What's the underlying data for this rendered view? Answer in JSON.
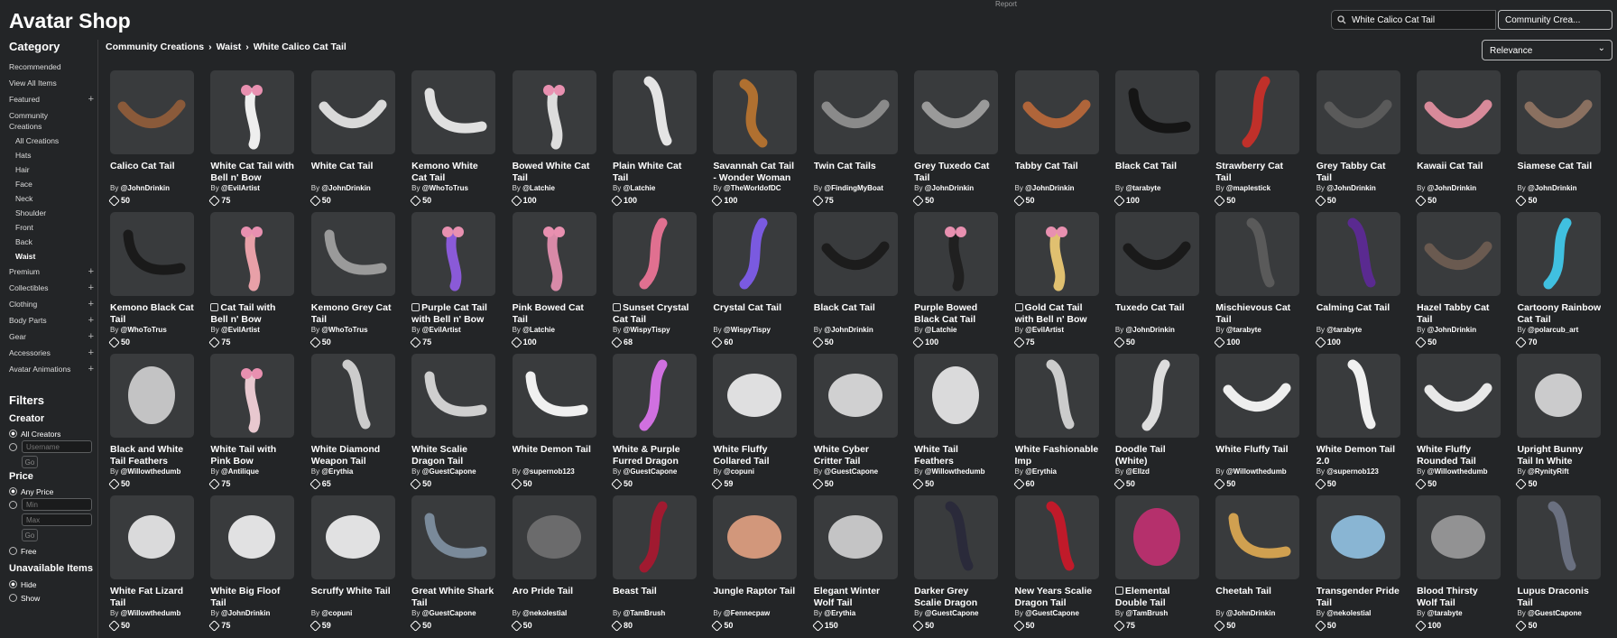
{
  "header": {
    "title": "Avatar Shop",
    "report": "Report"
  },
  "search": {
    "value": "White Calico Cat Tail",
    "category": "Community Crea..."
  },
  "sort": {
    "label": "Relevance"
  },
  "breadcrumb": [
    "Community Creations",
    "Waist",
    "White Calico Cat Tail"
  ],
  "sidebar": {
    "heading": "Category",
    "items": [
      {
        "label": "Recommended",
        "plus": false,
        "sub": false
      },
      {
        "label": "View All Items",
        "plus": false,
        "sub": false
      },
      {
        "label": "Featured",
        "plus": true,
        "sub": false
      },
      {
        "label": "Community Creations",
        "plus": false,
        "sub": false
      },
      {
        "label": "All Creations",
        "plus": false,
        "sub": true
      },
      {
        "label": "Hats",
        "plus": false,
        "sub": true
      },
      {
        "label": "Hair",
        "plus": false,
        "sub": true
      },
      {
        "label": "Face",
        "plus": false,
        "sub": true
      },
      {
        "label": "Neck",
        "plus": false,
        "sub": true
      },
      {
        "label": "Shoulder",
        "plus": false,
        "sub": true
      },
      {
        "label": "Front",
        "plus": false,
        "sub": true
      },
      {
        "label": "Back",
        "plus": false,
        "sub": true
      },
      {
        "label": "Waist",
        "plus": false,
        "sub": true,
        "active": true
      },
      {
        "label": "Premium",
        "plus": true,
        "sub": false
      },
      {
        "label": "Collectibles",
        "plus": true,
        "sub": false
      },
      {
        "label": "Clothing",
        "plus": true,
        "sub": false
      },
      {
        "label": "Body Parts",
        "plus": true,
        "sub": false
      },
      {
        "label": "Gear",
        "plus": true,
        "sub": false
      },
      {
        "label": "Accessories",
        "plus": true,
        "sub": false
      },
      {
        "label": "Avatar Animations",
        "plus": true,
        "sub": false
      }
    ]
  },
  "filters": {
    "heading": "Filters",
    "creator": {
      "label": "Creator",
      "all": "All Creators",
      "username_placeholder": "Username",
      "go": "Go"
    },
    "price": {
      "label": "Price",
      "any": "Any Price",
      "min_placeholder": "Min",
      "max_placeholder": "Max",
      "go": "Go",
      "free": "Free"
    },
    "unavailable": {
      "label": "Unavailable Items",
      "hide": "Hide",
      "show": "Show"
    }
  },
  "colors": {
    "background": "#232527",
    "tile": "#393b3d"
  },
  "items": [
    {
      "name": "Calico Cat Tail",
      "creator": "@JohnDrinkin",
      "price": "50",
      "badge": false,
      "color": "#8a5a3a",
      "shape": "curl"
    },
    {
      "name": "White Cat Tail with Bell n' Bow",
      "creator": "@EvilArtist",
      "price": "75",
      "badge": false,
      "color": "#eeeeee",
      "shape": "bow"
    },
    {
      "name": "White Cat Tail",
      "creator": "@JohnDrinkin",
      "price": "50",
      "badge": false,
      "color": "#d9d9d9",
      "shape": "curl"
    },
    {
      "name": "Kemono White Cat Tail",
      "creator": "@WhoToTrus",
      "price": "50",
      "badge": false,
      "color": "#e0e0e0",
      "shape": "swoop"
    },
    {
      "name": "Bowed White Cat Tail",
      "creator": "@Latchie",
      "price": "100",
      "badge": false,
      "color": "#dddddd",
      "shape": "bow"
    },
    {
      "name": "Plain White Cat Tail",
      "creator": "@Latchie",
      "price": "100",
      "badge": false,
      "color": "#e4e4e4",
      "shape": "hook"
    },
    {
      "name": "Savannah Cat Tail - Wonder Woman",
      "creator": "@TheWorldofDC",
      "price": "100",
      "badge": false,
      "color": "#b07030",
      "shape": "s"
    },
    {
      "name": "Twin Cat Tails",
      "creator": "@FindingMyBoat",
      "price": "75",
      "badge": false,
      "color": "#8a8a8a",
      "shape": "curl"
    },
    {
      "name": "Grey Tuxedo Cat Tail",
      "creator": "@JohnDrinkin",
      "price": "50",
      "badge": false,
      "color": "#9a9a9a",
      "shape": "curl"
    },
    {
      "name": "Tabby Cat Tail",
      "creator": "@JohnDrinkin",
      "price": "50",
      "badge": false,
      "color": "#b0653a",
      "shape": "curl"
    },
    {
      "name": "Black Cat Tail",
      "creator": "@tarabyte",
      "price": "100",
      "badge": false,
      "color": "#151515",
      "shape": "swoop"
    },
    {
      "name": "Strawberry Cat Tail",
      "creator": "@maplestick",
      "price": "50",
      "badge": false,
      "color": "#c0302a",
      "shape": "vertical"
    },
    {
      "name": "Grey Tabby Cat Tail",
      "creator": "@JohnDrinkin",
      "price": "50",
      "badge": false,
      "color": "#5a5a5a",
      "shape": "curl"
    },
    {
      "name": "Kawaii Cat Tail",
      "creator": "@JohnDrinkin",
      "price": "50",
      "badge": false,
      "color": "#d88a9a",
      "shape": "curl"
    },
    {
      "name": "Siamese Cat Tail",
      "creator": "@JohnDrinkin",
      "price": "50",
      "badge": false,
      "color": "#8a7060",
      "shape": "curl"
    },
    {
      "name": "Kemono Black Cat Tail",
      "creator": "@WhoToTrus",
      "price": "50",
      "badge": false,
      "color": "#1a1a1a",
      "shape": "swoop"
    },
    {
      "name": "Cat Tail with Bell n' Bow",
      "creator": "@EvilArtist",
      "price": "75",
      "badge": true,
      "color": "#e8a0a8",
      "shape": "bow"
    },
    {
      "name": "Kemono Grey Cat Tail",
      "creator": "@WhoToTrus",
      "price": "50",
      "badge": false,
      "color": "#9a9a9a",
      "shape": "swoop"
    },
    {
      "name": "Purple Cat Tail with Bell n' Bow",
      "creator": "@EvilArtist",
      "price": "75",
      "badge": true,
      "color": "#8a5ad8",
      "shape": "bow"
    },
    {
      "name": "Pink Bowed Cat Tail",
      "creator": "@Latchie",
      "price": "100",
      "badge": false,
      "color": "#d88aa8",
      "shape": "bow"
    },
    {
      "name": "Sunset Crystal Cat Tail",
      "creator": "@WispyTispy",
      "price": "68",
      "badge": true,
      "color": "#e07090",
      "shape": "vertical"
    },
    {
      "name": "Crystal Cat Tail",
      "creator": "@WispyTispy",
      "price": "60",
      "badge": false,
      "color": "#7a5ae0",
      "shape": "vertical"
    },
    {
      "name": "Black Cat Tail",
      "creator": "@JohnDrinkin",
      "price": "50",
      "badge": false,
      "color": "#1c1c1c",
      "shape": "curl"
    },
    {
      "name": "Purple Bowed Black Cat Tail",
      "creator": "@Latchie",
      "price": "100",
      "badge": false,
      "color": "#202020",
      "shape": "bow"
    },
    {
      "name": "Gold Cat Tail with Bell n' Bow",
      "creator": "@EvilArtist",
      "price": "75",
      "badge": true,
      "color": "#e0c070",
      "shape": "bow"
    },
    {
      "name": "Tuxedo Cat Tail",
      "creator": "@JohnDrinkin",
      "price": "50",
      "badge": false,
      "color": "#1a1a1a",
      "shape": "curl"
    },
    {
      "name": "Mischievous Cat Tail",
      "creator": "@tarabyte",
      "price": "100",
      "badge": false,
      "color": "#5a5a5a",
      "shape": "hook"
    },
    {
      "name": "Calming Cat Tail",
      "creator": "@tarabyte",
      "price": "100",
      "badge": false,
      "color": "#5a2a90",
      "shape": "hook"
    },
    {
      "name": "Hazel Tabby Cat Tail",
      "creator": "@JohnDrinkin",
      "price": "50",
      "badge": false,
      "color": "#6a5a50",
      "shape": "curl"
    },
    {
      "name": "Cartoony Rainbow Cat Tail",
      "creator": "@polarcub_art",
      "price": "70",
      "badge": false,
      "color": "#40c0e0",
      "shape": "vertical"
    },
    {
      "name": "Black and White Tail Feathers",
      "creator": "@Willowthedumb",
      "price": "50",
      "badge": false,
      "color": "#cfcfcf",
      "shape": "fan"
    },
    {
      "name": "White Tail with Pink Bow",
      "creator": "@Antilique",
      "price": "75",
      "badge": false,
      "color": "#e8c8cf",
      "shape": "bow"
    },
    {
      "name": "White Diamond Weapon Tail",
      "creator": "@Erythia",
      "price": "65",
      "badge": false,
      "color": "#cccccc",
      "shape": "hook"
    },
    {
      "name": "White Scalie Dragon Tail",
      "creator": "@GuestCapone",
      "price": "50",
      "badge": false,
      "color": "#cfcfcf",
      "shape": "swoop"
    },
    {
      "name": "White Demon Tail",
      "creator": "@supernob123",
      "price": "50",
      "badge": false,
      "color": "#f0f0f0",
      "shape": "swoop"
    },
    {
      "name": "White & Purple Furred Dragon",
      "creator": "@GuestCapone",
      "price": "50",
      "badge": false,
      "color": "#d070e0",
      "shape": "vertical"
    },
    {
      "name": "White Fluffy Collared Tail",
      "creator": "@copuni",
      "price": "59",
      "badge": false,
      "color": "#eeeeee",
      "shape": "fluff"
    },
    {
      "name": "White Cyber Critter Tail",
      "creator": "@GuestCapone",
      "price": "50",
      "badge": false,
      "color": "#dddddd",
      "shape": "fluff"
    },
    {
      "name": "White Tail Feathers",
      "creator": "@Willowthedumb",
      "price": "50",
      "badge": false,
      "color": "#e8e8e8",
      "shape": "fan"
    },
    {
      "name": "White Fashionable Imp",
      "creator": "@Erythia",
      "price": "60",
      "badge": false,
      "color": "#cccccc",
      "shape": "hook"
    },
    {
      "name": "Doodle Tail (White)",
      "creator": "@Ellzd",
      "price": "50",
      "badge": false,
      "color": "#dddddd",
      "shape": "vertical"
    },
    {
      "name": "White Fluffy Tail",
      "creator": "@Willowthedumb",
      "price": "50",
      "badge": false,
      "color": "#eeeeee",
      "shape": "curl"
    },
    {
      "name": "White Demon Tail 2.0",
      "creator": "@supernob123",
      "price": "50",
      "badge": false,
      "color": "#f0f0f0",
      "shape": "hook"
    },
    {
      "name": "White Fluffy Rounded Tail",
      "creator": "@Willowthedumb",
      "price": "50",
      "badge": false,
      "color": "#e8e8e8",
      "shape": "curl"
    },
    {
      "name": "Upright Bunny Tail In White",
      "creator": "@RynityRift",
      "price": "50",
      "badge": false,
      "color": "#d8d8d8",
      "shape": "blob"
    },
    {
      "name": "White Fat Lizard Tail",
      "creator": "@Willowthedumb",
      "price": "50",
      "badge": false,
      "color": "#e8e8e8",
      "shape": "blob"
    },
    {
      "name": "White Big Floof Tail",
      "creator": "@JohnDrinkin",
      "price": "75",
      "badge": false,
      "color": "#f0f0f0",
      "shape": "blob"
    },
    {
      "name": "Scruffy White Tail",
      "creator": "@copuni",
      "price": "59",
      "badge": false,
      "color": "#f0f0f0",
      "shape": "fluff"
    },
    {
      "name": "Great White Shark Tail",
      "creator": "@GuestCapone",
      "price": "50",
      "badge": false,
      "color": "#7a8a9a",
      "shape": "swoop"
    },
    {
      "name": "Aro Pride Tail",
      "creator": "@nekolestial",
      "price": "50",
      "badge": false,
      "color": "#707070",
      "shape": "fluff"
    },
    {
      "name": "Beast Tail",
      "creator": "@TamBrush",
      "price": "80",
      "badge": false,
      "color": "#a01a30",
      "shape": "vertical"
    },
    {
      "name": "Jungle Raptor Tail",
      "creator": "@Fennecpaw",
      "price": "50",
      "badge": false,
      "color": "#e0a080",
      "shape": "fluff"
    },
    {
      "name": "Elegant Winter Wolf Tail",
      "creator": "@Erythia",
      "price": "150",
      "badge": false,
      "color": "#d0d0d0",
      "shape": "fluff"
    },
    {
      "name": "Darker Grey Scalie Dragon",
      "creator": "@GuestCapone",
      "price": "50",
      "badge": false,
      "color": "#2a2a3a",
      "shape": "hook"
    },
    {
      "name": "New Years Scalie Dragon Tail",
      "creator": "@GuestCapone",
      "price": "50",
      "badge": false,
      "color": "#c01a2a",
      "shape": "hook"
    },
    {
      "name": "Elemental Double Tail",
      "creator": "@TamBrush",
      "price": "75",
      "badge": true,
      "color": "#c03070",
      "shape": "fan"
    },
    {
      "name": "Cheetah Tail",
      "creator": "@JohnDrinkin",
      "price": "50",
      "badge": false,
      "color": "#d0a050",
      "shape": "swoop"
    },
    {
      "name": "Transgender Pride Tail",
      "creator": "@nekolestial",
      "price": "50",
      "badge": false,
      "color": "#90c0e0",
      "shape": "fluff"
    },
    {
      "name": "Blood Thirsty Wolf Tail",
      "creator": "@tarabyte",
      "price": "100",
      "badge": false,
      "color": "#9a9a9a",
      "shape": "fluff"
    },
    {
      "name": "Lupus Draconis Tail",
      "creator": "@GuestCapone",
      "price": "50",
      "badge": false,
      "color": "#6a7080",
      "shape": "hook"
    }
  ]
}
